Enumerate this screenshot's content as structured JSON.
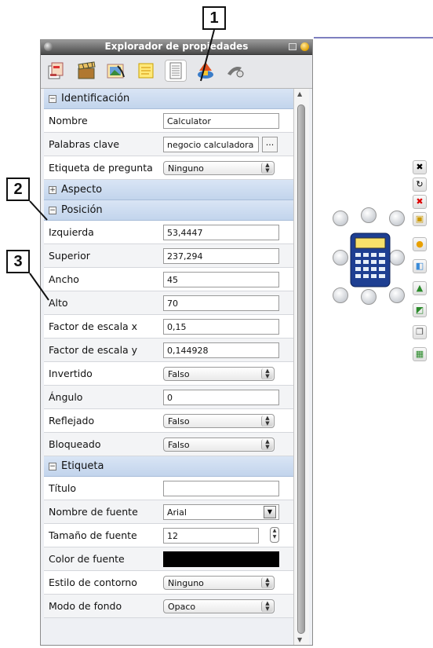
{
  "window": {
    "title": "Explorador de propiedades"
  },
  "toolbar": {
    "icons": [
      "page-styles-icon",
      "clapperboard-icon",
      "image-gallery-icon",
      "notes-icon",
      "properties-icon",
      "shapes-icon",
      "tools-icon"
    ],
    "selected_index": 4
  },
  "callouts": {
    "c1": "1",
    "c2": "2",
    "c3": "3"
  },
  "sections": {
    "identificacion": "Identificación",
    "aspecto": "Aspecto",
    "posicion": "Posición",
    "etiqueta": "Etiqueta"
  },
  "rows": {
    "nombre": {
      "label": "Nombre",
      "value": "Calculator"
    },
    "palabras": {
      "label": "Palabras clave",
      "value": "negocio calculadora",
      "button": "..."
    },
    "etiqueta_pregunta": {
      "label": "Etiqueta de pregunta",
      "value": "Ninguno"
    },
    "izquierda": {
      "label": "Izquierda",
      "value": "53,4447"
    },
    "superior": {
      "label": "Superior",
      "value": "237,294"
    },
    "ancho": {
      "label": "Ancho",
      "value": "45"
    },
    "alto": {
      "label": "Alto",
      "value": "70"
    },
    "escala_x": {
      "label": "Factor de escala x",
      "value": "0,15"
    },
    "escala_y": {
      "label": "Factor de escala y",
      "value": "0,144928"
    },
    "invertido": {
      "label": "Invertido",
      "value": "Falso"
    },
    "angulo": {
      "label": "Ángulo",
      "value": "0"
    },
    "reflejado": {
      "label": "Reflejado",
      "value": "Falso"
    },
    "bloqueado": {
      "label": "Bloqueado",
      "value": "Falso"
    },
    "titulo": {
      "label": "Título",
      "value": ""
    },
    "fuente": {
      "label": "Nombre de fuente",
      "value": "Arial"
    },
    "tamano": {
      "label": "Tamaño de fuente",
      "value": "12"
    },
    "color": {
      "label": "Color de fuente",
      "value_color": "#000000"
    },
    "contorno": {
      "label": "Estilo de contorno",
      "value": "Ninguno"
    },
    "fondo": {
      "label": "Modo de fondo",
      "value": "Opaco"
    }
  },
  "object_toolbar": {
    "icons": [
      "close-x-icon",
      "redo-icon",
      "delete-icon",
      "lock-icon",
      "color-icon",
      "layer-icon",
      "image-icon",
      "resize-icon",
      "copy-icon",
      "duplicate-icon"
    ]
  },
  "colors": {
    "accent": "#c2d4ec",
    "selected_handle": "#c8ccd2"
  }
}
